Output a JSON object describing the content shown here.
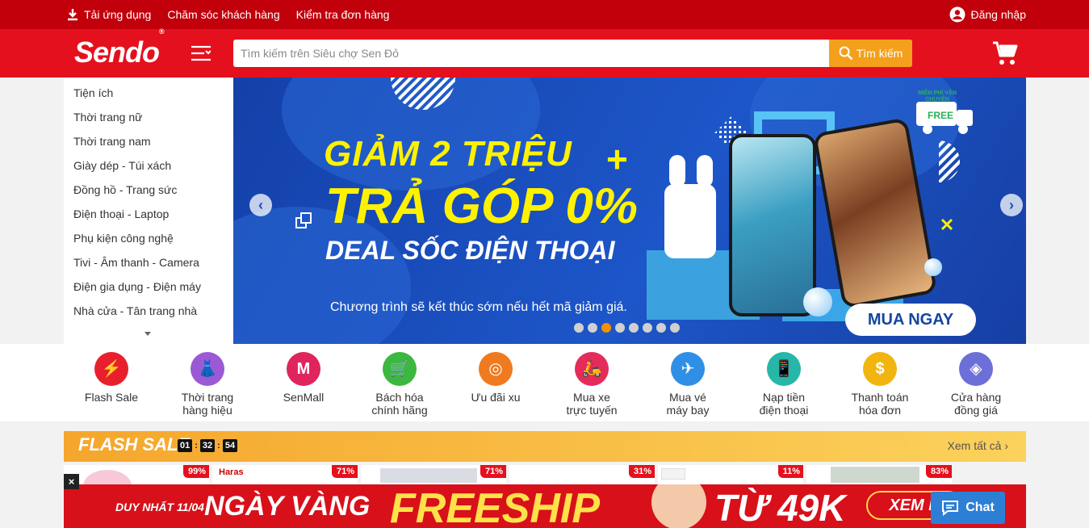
{
  "topbar": {
    "download_app": "Tải ứng dụng",
    "customer_care": "Chăm sóc khách hàng",
    "check_order": "Kiểm tra đơn hàng",
    "login": "Đăng nhập"
  },
  "header": {
    "logo": "Sendo",
    "logo_mark": "®",
    "search_placeholder": "Tìm kiếm trên Siêu chợ Sen Đỏ",
    "search_button": "Tìm kiếm"
  },
  "sidebar": {
    "items": [
      {
        "label": "Tiện ích"
      },
      {
        "label": "Thời trang nữ"
      },
      {
        "label": "Thời trang nam"
      },
      {
        "label": "Giày dép - Túi xách"
      },
      {
        "label": "Đồng hồ - Trang sức"
      },
      {
        "label": "Điện thoại - Laptop"
      },
      {
        "label": "Phụ kiện công nghệ"
      },
      {
        "label": "Tivi - Âm thanh - Camera"
      },
      {
        "label": "Điện gia dụng - Điện máy"
      },
      {
        "label": "Nhà cửa - Tân trang nhà"
      }
    ]
  },
  "banner": {
    "line1": "GIẢM 2 TRIỆU",
    "plus": "+",
    "line2": "TRẢ GÓP 0%",
    "line3": "DEAL SỐC ĐIỆN THOẠI",
    "note": "Chương trình sẽ kết thúc sớm nếu hết mã giảm giá.",
    "cta": "MUA NGAY",
    "badge_top": "MIỄN PHÍ VẬN CHUYỂN",
    "badge_free": "FREE",
    "prev": "‹",
    "next": "›",
    "slides": 8,
    "active_slide": 3
  },
  "quick_links": [
    {
      "label": "Flash Sale",
      "color": "#e8202e",
      "icon": "⚡"
    },
    {
      "label": "Thời trang hàng hiệu",
      "color": "#9b59d6",
      "icon": "👗"
    },
    {
      "label": "SenMall",
      "color": "#e0245e",
      "icon": "M"
    },
    {
      "label": "Bách hóa chính hãng",
      "color": "#3cb73f",
      "icon": "🛒"
    },
    {
      "label": "Ưu đãi xu",
      "color": "#f07a1f",
      "icon": "◎"
    },
    {
      "label": "Mua xe trực tuyến",
      "color": "#e42c5b",
      "icon": "🛵"
    },
    {
      "label": "Mua vé máy bay",
      "color": "#2f8fe6",
      "icon": "✈"
    },
    {
      "label": "Nạp tiền điện thoại",
      "color": "#26b7a8",
      "icon": "📱"
    },
    {
      "label": "Thanh toán hóa đơn",
      "color": "#f2b40f",
      "icon": "$"
    },
    {
      "label": "Cửa hàng đồng giá",
      "color": "#6c6fd8",
      "icon": "◈"
    }
  ],
  "flash_sale": {
    "title": "FLASH SALE",
    "hours": "01",
    "minutes": "32",
    "seconds": "54",
    "see_all": "Xem tất cả"
  },
  "products": [
    {
      "discount": "99%",
      "brand": ""
    },
    {
      "discount": "71%",
      "brand": "Haras"
    },
    {
      "discount": "71%",
      "brand": ""
    },
    {
      "discount": "31%",
      "brand": ""
    },
    {
      "discount": "11%",
      "brand": ""
    },
    {
      "discount": "83%",
      "brand": ""
    }
  ],
  "promo": {
    "only": "DUY NHẤT 11/04",
    "golden": "NGÀY VÀNG",
    "freeship": "FREESHIP",
    "from": "TỪ 49K",
    "cta": "XEM N"
  },
  "close_label": "×",
  "chat_label": "Chat",
  "colors": {
    "topbar": "#c1000b",
    "header": "#e5101d",
    "search_button": "#f4a01d",
    "banner": "#1d56c9",
    "headline": "#fff200"
  }
}
